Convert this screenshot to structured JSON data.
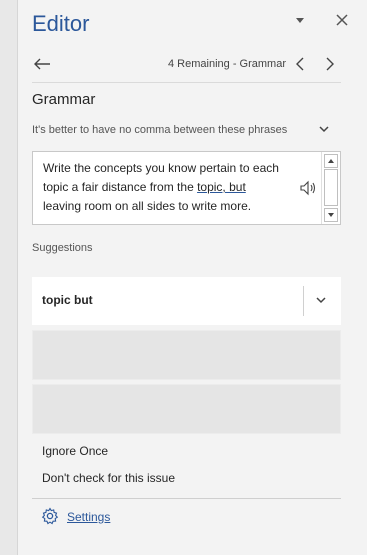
{
  "header": {
    "title": "Editor"
  },
  "nav": {
    "counter": "4 Remaining - Grammar"
  },
  "section": {
    "title": "Grammar"
  },
  "issue": {
    "text": "It's better to have no comma between these phrases"
  },
  "excerpt": {
    "line1": "Write the concepts you know pertain to each",
    "line2_before": "topic a fair distance from the ",
    "highlight": "topic, but",
    "line3": "leaving room on all sides to write more."
  },
  "suggestions": {
    "label": "Suggestions",
    "items": [
      "topic but"
    ]
  },
  "actions": {
    "ignore_once": "Ignore Once",
    "dont_check": "Don't check for this issue"
  },
  "footer": {
    "settings": "Settings"
  },
  "colors": {
    "accent": "#2b579a"
  }
}
